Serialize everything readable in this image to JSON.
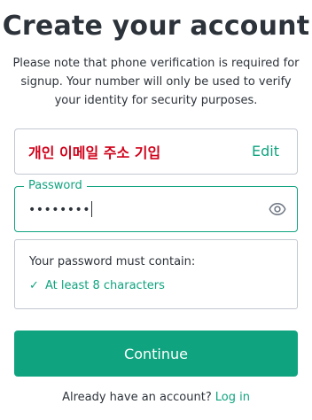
{
  "header": {
    "title": "Create your account",
    "note": "Please note that phone verification is required for signup. Your number will only be used to verify your identity for security purposes."
  },
  "email": {
    "value": "개인 이메일 주소 기입",
    "edit_label": "Edit"
  },
  "password": {
    "label": "Password",
    "masked_value": "••••••••",
    "toggle_icon": "eye-icon"
  },
  "requirements": {
    "title": "Your password must contain:",
    "items": [
      {
        "icon": "✓",
        "label": "At least 8 characters",
        "met": true
      }
    ]
  },
  "actions": {
    "continue_label": "Continue"
  },
  "footer": {
    "prompt": "Already have an account?",
    "login_label": "Log in"
  },
  "colors": {
    "accent": "#10a37f",
    "text": "#2d333a",
    "border": "#c2c8d0",
    "email_text": "#d0021b"
  }
}
